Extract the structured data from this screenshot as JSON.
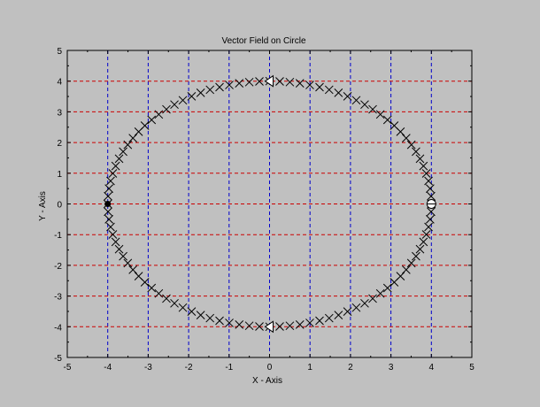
{
  "chart_data": {
    "type": "scatter",
    "title": "Vector Field on Circle",
    "xlabel": "X - Axis",
    "ylabel": "Y - Axis",
    "xlim": [
      -5,
      5
    ],
    "ylim": [
      -5,
      5
    ],
    "x_ticks": [
      "-5",
      "-4",
      "-3",
      "-2",
      "-1",
      "0",
      "1",
      "2",
      "3",
      "4",
      "5"
    ],
    "y_ticks": [
      "-5",
      "-4",
      "-3",
      "-2",
      "-1",
      "0",
      "1",
      "2",
      "3",
      "4",
      "5"
    ],
    "grid": true,
    "grid_x_color": "#0000cc",
    "grid_y_color": "#cc0000",
    "background_color": "#c0c0c0",
    "circle_radius": 4,
    "marker": "x",
    "marker_count": 100,
    "special_points": [
      {
        "x": -4,
        "y": 0,
        "marker": "filled-circle"
      },
      {
        "x": 4,
        "y": 0,
        "marker": "open-circle"
      },
      {
        "x": 0,
        "y": 4,
        "marker": "triangle-left"
      },
      {
        "x": 0,
        "y": -4,
        "marker": "triangle-left"
      }
    ]
  }
}
